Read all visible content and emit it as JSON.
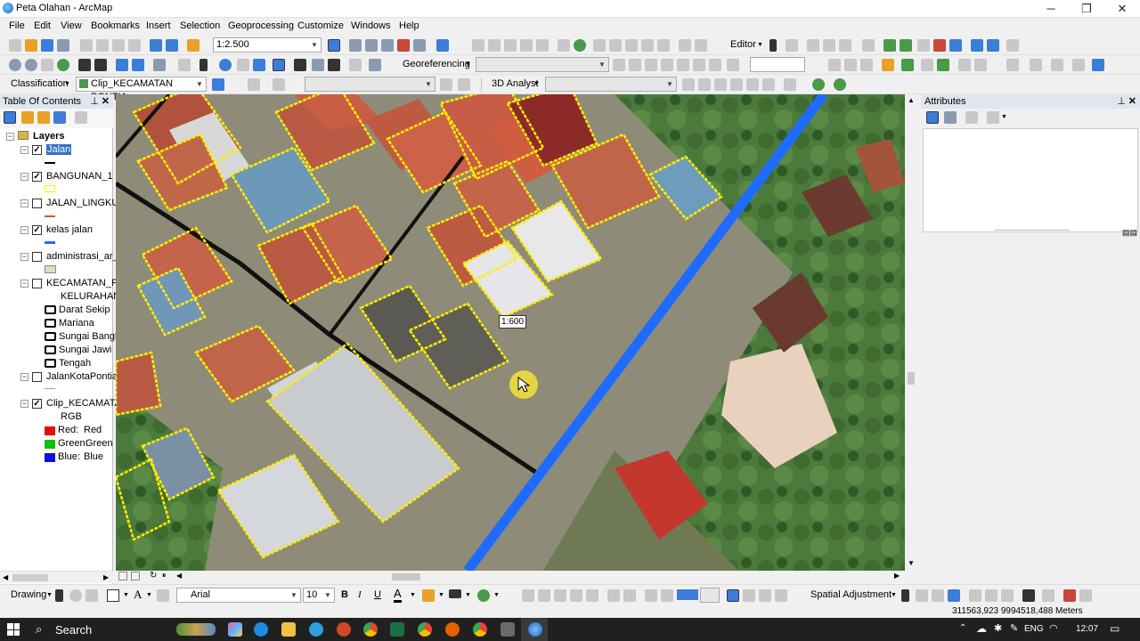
{
  "window": {
    "title": "Peta Olahan - ArcMap",
    "minimize": "─",
    "maximize": "❐",
    "close": "✕"
  },
  "menu": [
    "File",
    "Edit",
    "View",
    "Bookmarks",
    "Insert",
    "Selection",
    "Geoprocessing",
    "Customize",
    "Windows",
    "Help"
  ],
  "toolbar1": {
    "scale": "1:2.500",
    "editor": "Editor"
  },
  "toolbar2": {
    "georeferencing": "Georeferencing"
  },
  "toolbar3": {
    "classification": "Classification",
    "layer": "Clip_KECAMATAN PONTIA",
    "analyst": "3D Analyst"
  },
  "toc": {
    "title": "Table Of Contents",
    "root": "Layers",
    "layers": [
      {
        "name": "Jalan",
        "checked": true,
        "selected": true
      },
      {
        "name": "BANGUNAN_1",
        "checked": true
      },
      {
        "name": "JALAN_LINGKUN",
        "checked": false
      },
      {
        "name": "kelas jalan",
        "checked": true
      },
      {
        "name": "administrasi_ar_",
        "checked": false
      },
      {
        "name": "KECAMATAN_P(",
        "checked": false
      },
      {
        "name": "JalanKotaPontia",
        "checked": false
      },
      {
        "name": "Clip_KECAMATA",
        "checked": true
      }
    ],
    "kelurahan_header": "KELURAHAN",
    "kelurahan": [
      "Darat Sekip",
      "Mariana",
      "Sungai Bangk",
      "Sungai Jawi",
      "Tengah"
    ],
    "rgb_header": "RGB",
    "rgb": [
      {
        "band": "Red:",
        "value": "Red",
        "color": "#e01010"
      },
      {
        "band": "Green:",
        "value": "Green",
        "color": "#10c010"
      },
      {
        "band": "Blue:",
        "value": "Blue",
        "color": "#1010e0"
      }
    ]
  },
  "map": {
    "tooltip": "1:600"
  },
  "attributes": {
    "title": "Attributes"
  },
  "drawing": {
    "label": "Drawing",
    "font": "Arial",
    "size": "10",
    "bold": "B",
    "italic": "I",
    "underline": "U",
    "text_a": "A",
    "spatial": "Spatial Adjustment"
  },
  "status": {
    "coords": "311563,923  9994518,488 Meters"
  },
  "taskbar": {
    "search": "Search",
    "lang": "ENG",
    "time": "12:07"
  },
  "colors": {
    "road_black": "#111111",
    "road_blue": "#1e6bff",
    "building_outline": "#ffee00"
  }
}
